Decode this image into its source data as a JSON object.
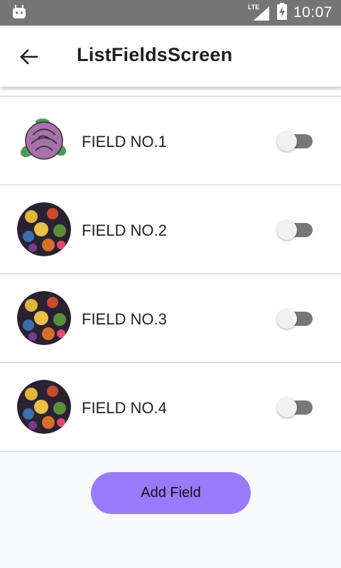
{
  "status_bar": {
    "time": "10:07",
    "network_label": "LTE",
    "icons": [
      "android-icon",
      "lte-signal-icon",
      "battery-charging-icon"
    ]
  },
  "app_bar": {
    "title": "ListFieldsScreen",
    "back_icon": "arrow-back-icon"
  },
  "fields": [
    {
      "label": "FIELD NO.1",
      "enabled": false,
      "image": "purple-rose"
    },
    {
      "label": "FIELD NO.2",
      "enabled": false,
      "image": "fruit-pattern"
    },
    {
      "label": "FIELD NO.3",
      "enabled": false,
      "image": "fruit-pattern"
    },
    {
      "label": "FIELD NO.4",
      "enabled": false,
      "image": "fruit-pattern"
    }
  ],
  "add_button": {
    "label": "Add Field"
  },
  "colors": {
    "status_bar": "#757575",
    "accent_button": "#9a79fa",
    "switch_track": "#777777",
    "switch_thumb": "#f1f1f1",
    "background": "#f8f9fc"
  }
}
